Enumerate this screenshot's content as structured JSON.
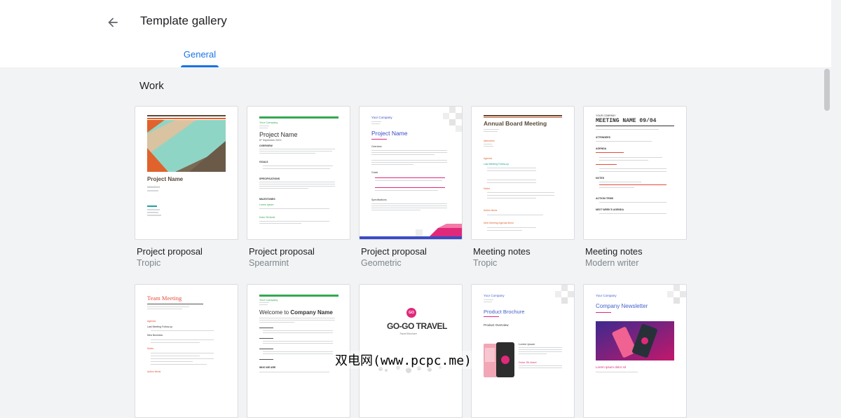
{
  "header": {
    "title": "Template gallery",
    "tab_label": "General"
  },
  "section": {
    "title": "Work"
  },
  "row1": [
    {
      "name": "Project proposal",
      "style": "Tropic",
      "preview": {
        "title": "Project Name",
        "subtitle": "09/04/20XX"
      }
    },
    {
      "name": "Project proposal",
      "style": "Spearmint",
      "preview": {
        "company": "Your Company",
        "title": "Project Name",
        "date": "8ᵗʰ September 20XX",
        "overview": "OVERVIEW",
        "goals": "GOALS",
        "specs": "SPECIFICATIONS",
        "milestones": "MILESTONES",
        "lorem": "Lorem Ipsum",
        "dolor": "Dolor Sit Amet"
      }
    },
    {
      "name": "Project proposal",
      "style": "Geometric",
      "preview": {
        "company": "Your Company",
        "title": "Project Name",
        "overview": "Overview",
        "goals": "Goals",
        "specs": "Specifications"
      }
    },
    {
      "name": "Meeting notes",
      "style": "Tropic",
      "preview": {
        "title": "Annual Board Meeting",
        "attendees": "Attendees",
        "agenda": "Agenda",
        "last": "Last Meeting Follow-up",
        "notes": "Notes",
        "action": "Action Items",
        "next": "Next Meeting Agenda Items"
      }
    },
    {
      "name": "Meeting notes",
      "style": "Modern writer",
      "preview": {
        "company": "YOUR COMPANY",
        "title": "MEETING NAME 09/04",
        "attendees": "ATTENDEES",
        "agenda": "AGENDA",
        "notes": "NOTES",
        "action": "ACTION ITEMS",
        "next": "NEXT WEEK'S AGENDA"
      }
    }
  ],
  "row2": [
    {
      "preview": {
        "title": "Team Meeting",
        "agenda": "Agenda",
        "last": "Last Meeting Follow-up",
        "new": "New Business",
        "notes": "Notes",
        "action": "Action Items"
      }
    },
    {
      "preview": {
        "company": "Your Company",
        "welcome": "Welcome to ",
        "company_bold": "Company Name",
        "who": "WHO WE ARE"
      }
    },
    {
      "preview": {
        "logo": "GO",
        "title": "GO-GO TRAVEL",
        "subtitle": "Travel Brochure"
      }
    },
    {
      "preview": {
        "company": "Your Company",
        "title": "Product Brochure",
        "overview": "Product Overview",
        "lorem": "Lorem Ipsum",
        "dolor": "Dolor Sit Amet"
      }
    },
    {
      "preview": {
        "company": "Your Company",
        "title": "Company Newsletter",
        "caption": "Lorem ipsum dolor sit"
      }
    }
  ],
  "watermark": "双电网(www.pcpc.me)",
  "colors": {
    "accent": "#1a73e8",
    "tropic_orange": "#e0622c",
    "tropic_teal": "#1ba39c",
    "spearmint": "#34a853",
    "geometric_blue": "#3c4bc4",
    "geometric_pink": "#e0297a",
    "meeting_red": "#e74c3c",
    "brochure_blue": "#4361cc"
  }
}
